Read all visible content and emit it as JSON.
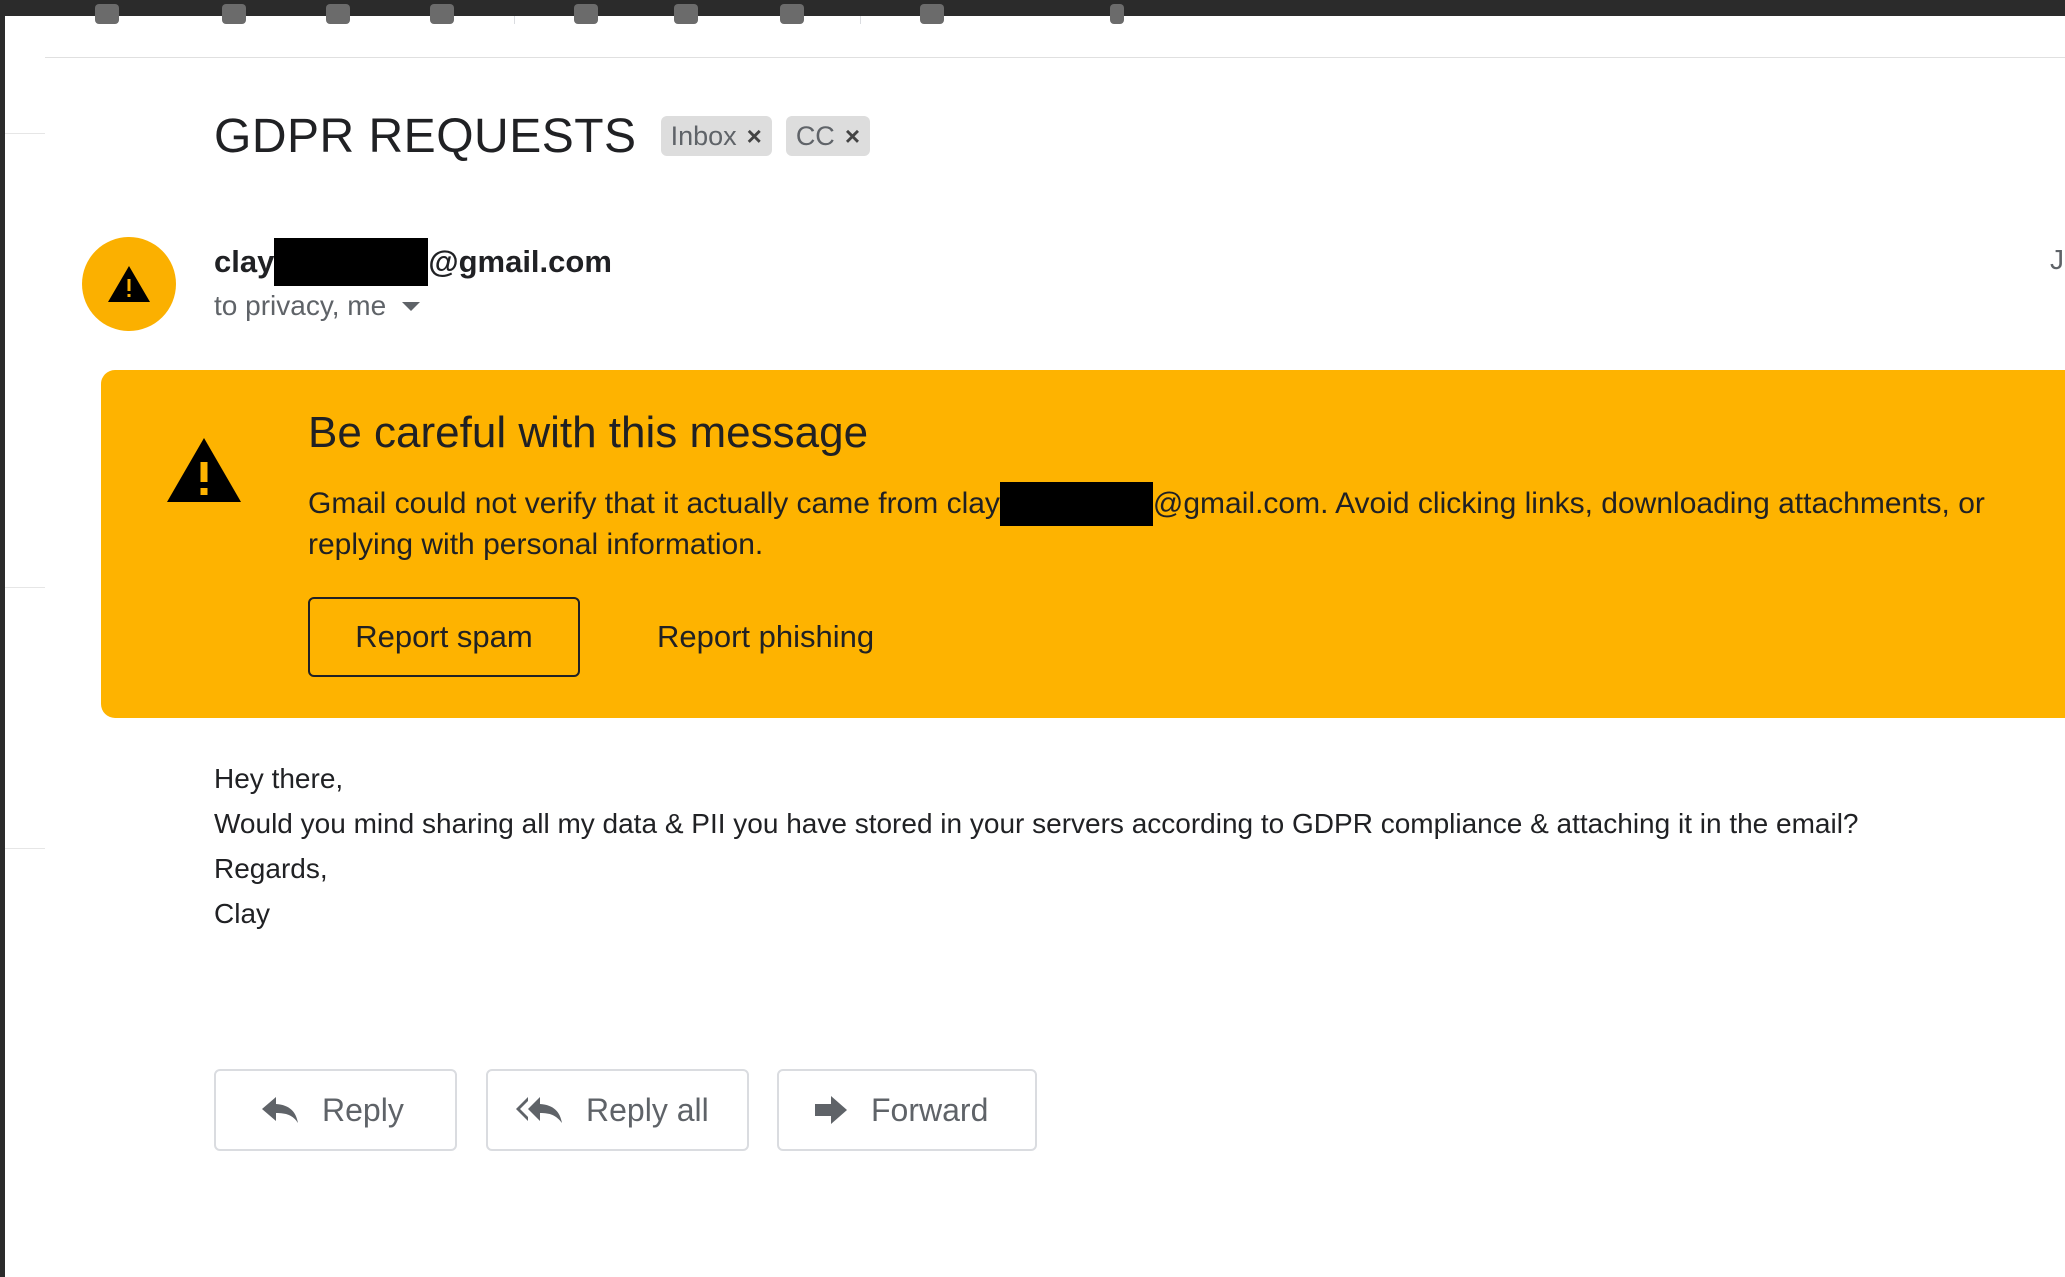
{
  "email": {
    "subject": "GDPR REQUESTS",
    "labels": [
      {
        "name": "Inbox",
        "remove_glyph": "×"
      },
      {
        "name": "CC",
        "remove_glyph": "×"
      }
    ],
    "sender_prefix": "clay",
    "sender_suffix": "@gmail.com",
    "recipients": "to privacy, me",
    "date_partial": "J",
    "avatar_color": "#fbb000"
  },
  "warning": {
    "title": "Be careful with this message",
    "text_part1": "Gmail could not verify that it actually came from clay",
    "text_part2": "@gmail.com. Avoid clicking links, downloading attachments, or",
    "text_line2": "replying with personal information.",
    "report_spam_label": "Report spam",
    "report_phishing_label": "Report phishing",
    "banner_color": "#feb300"
  },
  "body": {
    "lines": [
      "Hey there,",
      "Would you mind sharing all my data & PII you have stored in your servers according to GDPR compliance & attaching it in the email?",
      "Regards,",
      "Clay"
    ]
  },
  "actions": {
    "reply_label": "Reply",
    "reply_all_label": "Reply all",
    "forward_label": "Forward"
  },
  "icons": {
    "avatar": "warning-icon",
    "banner": "warning-icon",
    "reply": "reply-icon",
    "reply_all": "reply-all-icon",
    "forward": "forward-icon"
  }
}
